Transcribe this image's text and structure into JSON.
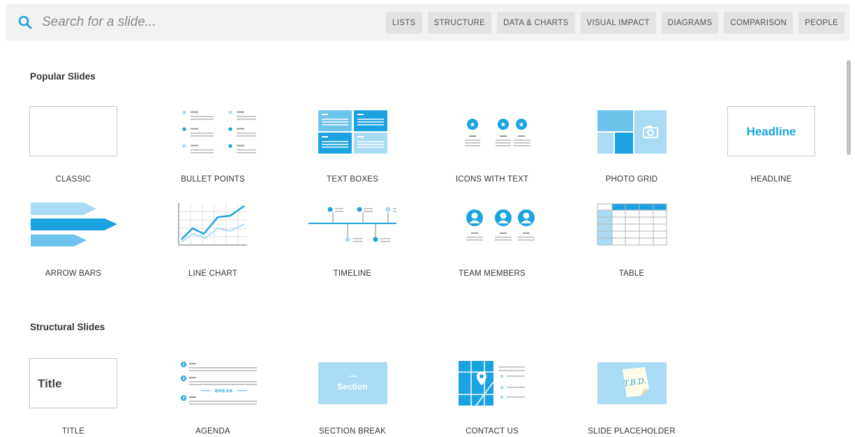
{
  "search": {
    "placeholder": "Search for a slide..."
  },
  "filters": [
    "LISTS",
    "STRUCTURE",
    "DATA & CHARTS",
    "VISUAL IMPACT",
    "DIAGRAMS",
    "COMPARISON",
    "PEOPLE"
  ],
  "sections": {
    "popular": {
      "title": "Popular Slides",
      "items": [
        "CLASSIC",
        "BULLET POINTS",
        "TEXT BOXES",
        "ICONS WITH TEXT",
        "PHOTO GRID",
        "HEADLINE",
        "ARROW BARS",
        "LINE CHART",
        "TIMELINE",
        "TEAM MEMBERS",
        "TABLE"
      ]
    },
    "structural": {
      "title": "Structural Slides",
      "items": [
        "TITLE",
        "AGENDA",
        "SECTION BREAK",
        "CONTACT US",
        "SLIDE PLACEHOLDER"
      ]
    }
  },
  "thumb_text": {
    "headline": "Headline",
    "title": "Title",
    "break": "BREAK",
    "section": "Section",
    "tbd": "T.B.D.",
    "agenda_numbers": [
      "1",
      "2",
      "3"
    ]
  },
  "colors": {
    "accent": "#1aa3e0",
    "light": "#a9dcf4",
    "mid": "#6cc3ec",
    "topbar": "#f2f2f2",
    "chip": "#e3e3e3"
  }
}
